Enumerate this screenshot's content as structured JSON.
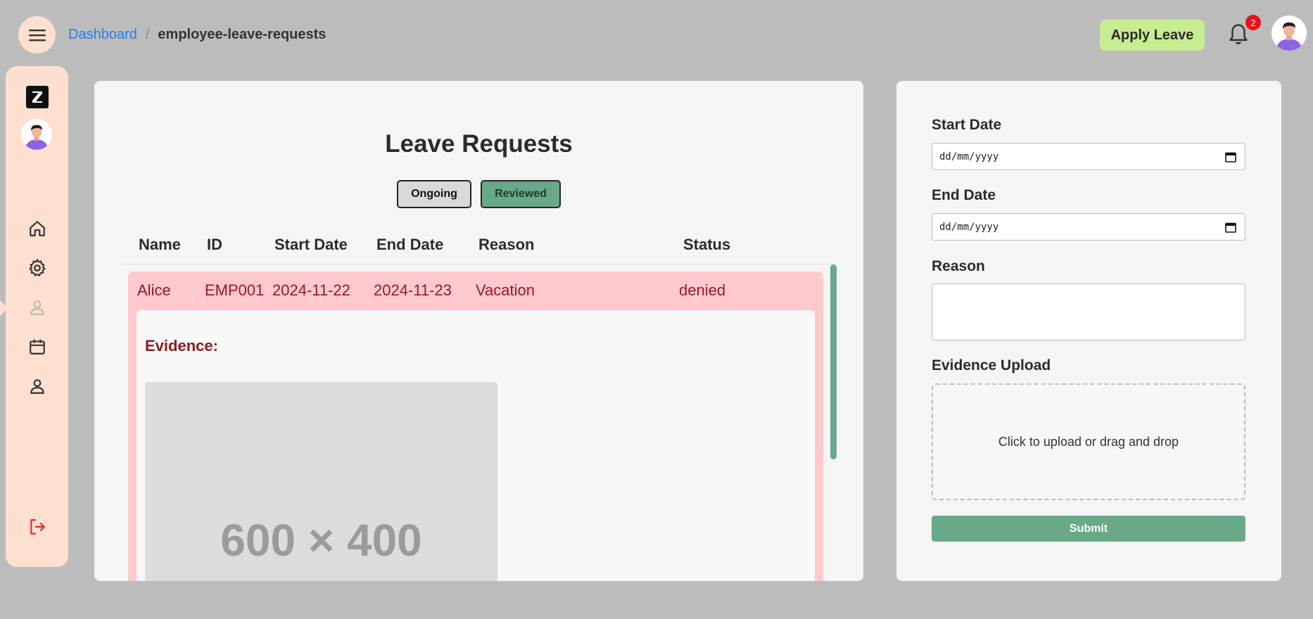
{
  "header": {
    "breadcrumb_root": "Dashboard",
    "breadcrumb_sep": "/",
    "breadcrumb_current": "employee-leave-requests",
    "apply_button_label": "Apply Leave",
    "notification_count": "2"
  },
  "sidebar": {
    "items": [
      {
        "icon": "home-icon"
      },
      {
        "icon": "gear-icon"
      },
      {
        "icon": "user-icon",
        "active": true
      },
      {
        "icon": "calendar-icon"
      },
      {
        "icon": "person-icon"
      }
    ],
    "logout_icon": "logout-icon"
  },
  "main": {
    "title": "Leave Requests",
    "tabs": [
      {
        "label": "Ongoing"
      },
      {
        "label": "Reviewed"
      }
    ],
    "columns": [
      "Name",
      "ID",
      "Start Date",
      "End Date",
      "Reason",
      "Status"
    ],
    "rows": [
      {
        "name": "Alice",
        "id": "EMP001",
        "start_date": "2024-11-22",
        "end_date": "2024-11-23",
        "reason": "Vacation",
        "status": "denied",
        "evidence_label": "Evidence:",
        "evidence_placeholder": "600 × 400"
      }
    ]
  },
  "form": {
    "start_label": "Start Date",
    "start_placeholder": "dd/mm/yyyy",
    "end_label": "End Date",
    "end_placeholder": "dd/mm/yyyy",
    "reason_label": "Reason",
    "reason_value": "",
    "upload_label": "Evidence Upload",
    "upload_hint": "Click to upload or drag and drop",
    "submit_label": "Submit"
  },
  "colors": {
    "accent": "#69a98a",
    "apply": "#c8ec91",
    "sidebar": "#ffe0d0",
    "denied_row": "#ffc9ce",
    "link": "#2a7de1"
  }
}
